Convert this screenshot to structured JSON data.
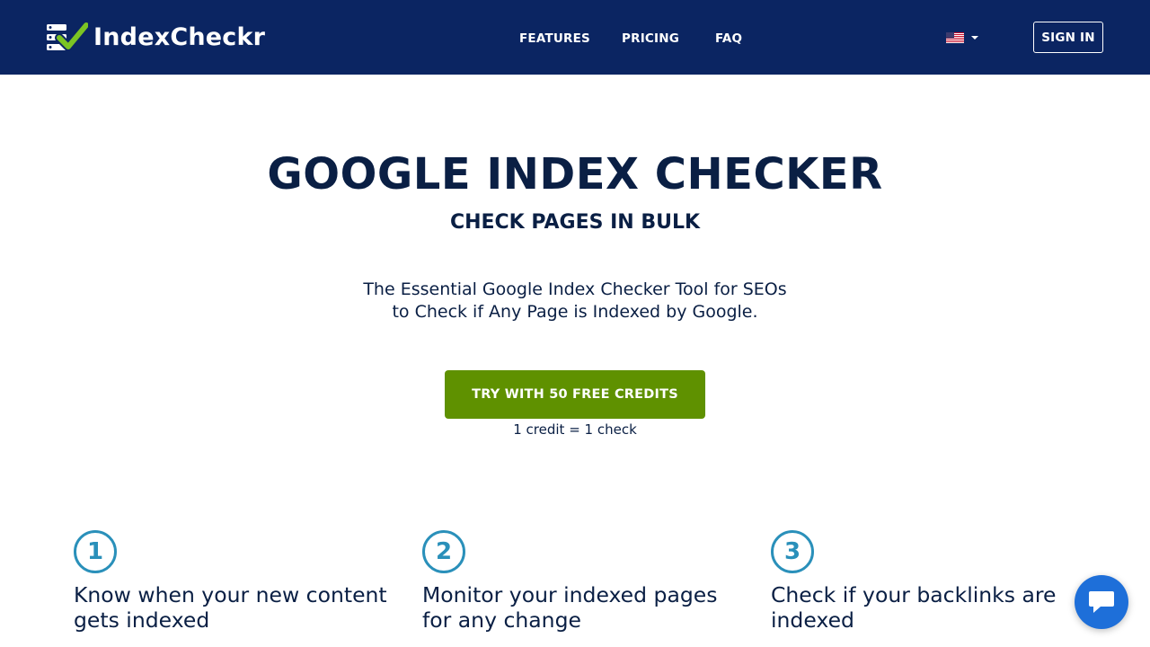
{
  "brand": {
    "name": "IndexCheckr"
  },
  "nav": {
    "features": "FEATURES",
    "pricing": "PRICING",
    "faq": "FAQ",
    "sign_in": "SIGN IN",
    "language_flag": "us-flag-icon"
  },
  "hero": {
    "title": "GOOGLE INDEX CHECKER",
    "subtitle": "CHECK PAGES IN BULK",
    "desc_line1": "The Essential Google Index Checker Tool for SEOs",
    "desc_line2": "to Check if Any Page is Indexed by Google.",
    "cta_label": "TRY WITH 50 FREE CREDITS",
    "cta_note": "1 credit = 1 check"
  },
  "features": [
    {
      "number": "1",
      "title_line1": "Know when your new content",
      "title_line2": "gets indexed"
    },
    {
      "number": "2",
      "title_line1": "Monitor your indexed pages",
      "title_line2": "for any change"
    },
    {
      "number": "3",
      "title_line1": "Check if your backlinks are",
      "title_line2": "indexed"
    }
  ],
  "chat": {
    "icon": "chat-bubble-icon"
  },
  "colors": {
    "navbar": "#0b2562",
    "cta": "#5f9100",
    "number_accent": "#2a90ba",
    "chat": "#1e6fd9",
    "logo_check": "#7cc423"
  }
}
